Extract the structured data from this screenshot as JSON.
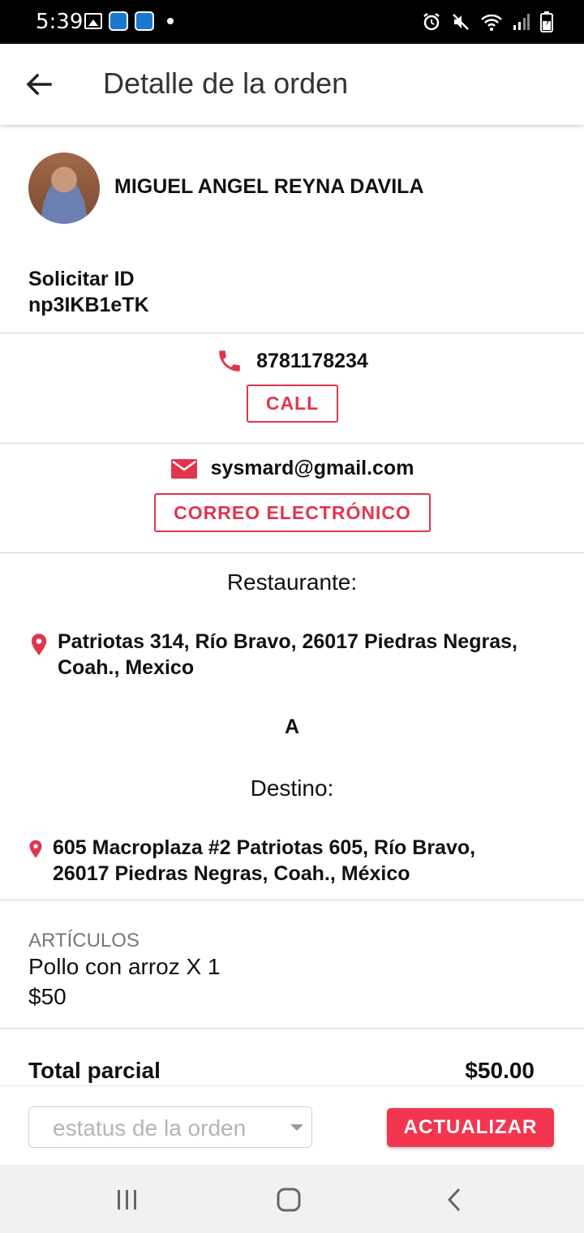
{
  "status_bar": {
    "time": "5:39",
    "left_icons": [
      "image-icon",
      "app-icon",
      "app-icon",
      "dot-icon"
    ],
    "right_icons": [
      "alarm-icon",
      "mute-icon",
      "wifi-icon",
      "signal-icon",
      "battery-icon"
    ]
  },
  "app_bar": {
    "title": "Detalle de la orden",
    "back_icon": "arrow-back-icon"
  },
  "customer": {
    "name": "MIGUEL ANGEL REYNA DAVILA"
  },
  "request": {
    "label": "Solicitar ID",
    "id": "np3IKB1eTK"
  },
  "phone": {
    "number": "8781178234",
    "call_label": "CALL"
  },
  "email": {
    "address": "sysmard@gmail.com",
    "button_label": "CORREO ELECTRÓNICO"
  },
  "route": {
    "origin_label": "Restaurante:",
    "origin_address": "Patriotas 314, Río Bravo, 26017 Piedras Negras, Coah., Mexico",
    "connector": "A",
    "destination_label": "Destino:",
    "destination_address": "605 Macroplaza #2 Patriotas 605, Río Bravo, 26017 Piedras Negras, Coah., México"
  },
  "items": {
    "label": "ARTÍCULOS",
    "list": [
      {
        "name": "Pollo con arroz X 1",
        "price": "$50"
      }
    ]
  },
  "summary": {
    "subtotal_label": "Total parcial",
    "subtotal_value": "$50.00"
  },
  "actions": {
    "status_placeholder": "estatus de la orden",
    "update_label": "ACTUALIZAR"
  },
  "colors": {
    "accent": "#e0354d",
    "button_fill": "#f2364f"
  }
}
